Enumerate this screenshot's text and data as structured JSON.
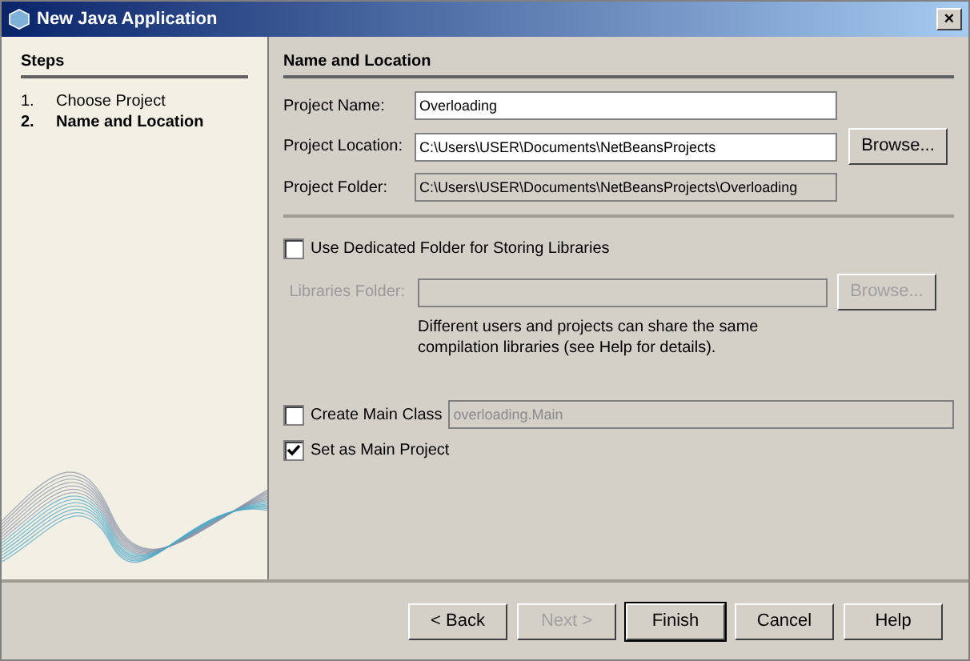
{
  "window": {
    "title": "New Java Application",
    "close": "×"
  },
  "steps": {
    "title": "Steps",
    "items": [
      {
        "number": "1.",
        "label": "Choose Project",
        "selected": false
      },
      {
        "number": "2.",
        "label": "Name and Location",
        "selected": true
      }
    ]
  },
  "panel_title": "Name and Location",
  "fields": [
    {
      "label": "Project Name:",
      "value": "Overloading",
      "disabled": false
    },
    {
      "label": "Project Location:",
      "value": "C:\\Users\\USER\\Documents\\NetBeansProjects",
      "disabled": false,
      "button": "Browse..."
    },
    {
      "label": "Project Folder:",
      "value": "C:\\Users\\USER\\Documents\\NetBeansProjects\\Overloading",
      "disabled": true
    }
  ],
  "libraries": {
    "checkbox": {
      "label": "Use Dedicated Folder for Storing Libraries",
      "checked": false
    },
    "label": "Libraries Folder:",
    "disabled": true,
    "button": "Browse...",
    "note": "Different users and projects can share the same compilation libraries (see Help for details)."
  },
  "main_class": {
    "label": "Create Main Class",
    "checked": false,
    "value": "overloading.Main"
  },
  "main_project": {
    "label": "Set as Main Project",
    "checked": true
  },
  "buttons": [
    {
      "label": "< Back",
      "disabled": false,
      "default": false
    },
    {
      "label": "Next >",
      "disabled": true,
      "default": false
    },
    {
      "label": "Finish",
      "disabled": false,
      "default": true
    },
    {
      "label": "Cancel",
      "disabled": false,
      "default": false
    },
    {
      "label": "Help",
      "disabled": false,
      "default": false
    }
  ]
}
